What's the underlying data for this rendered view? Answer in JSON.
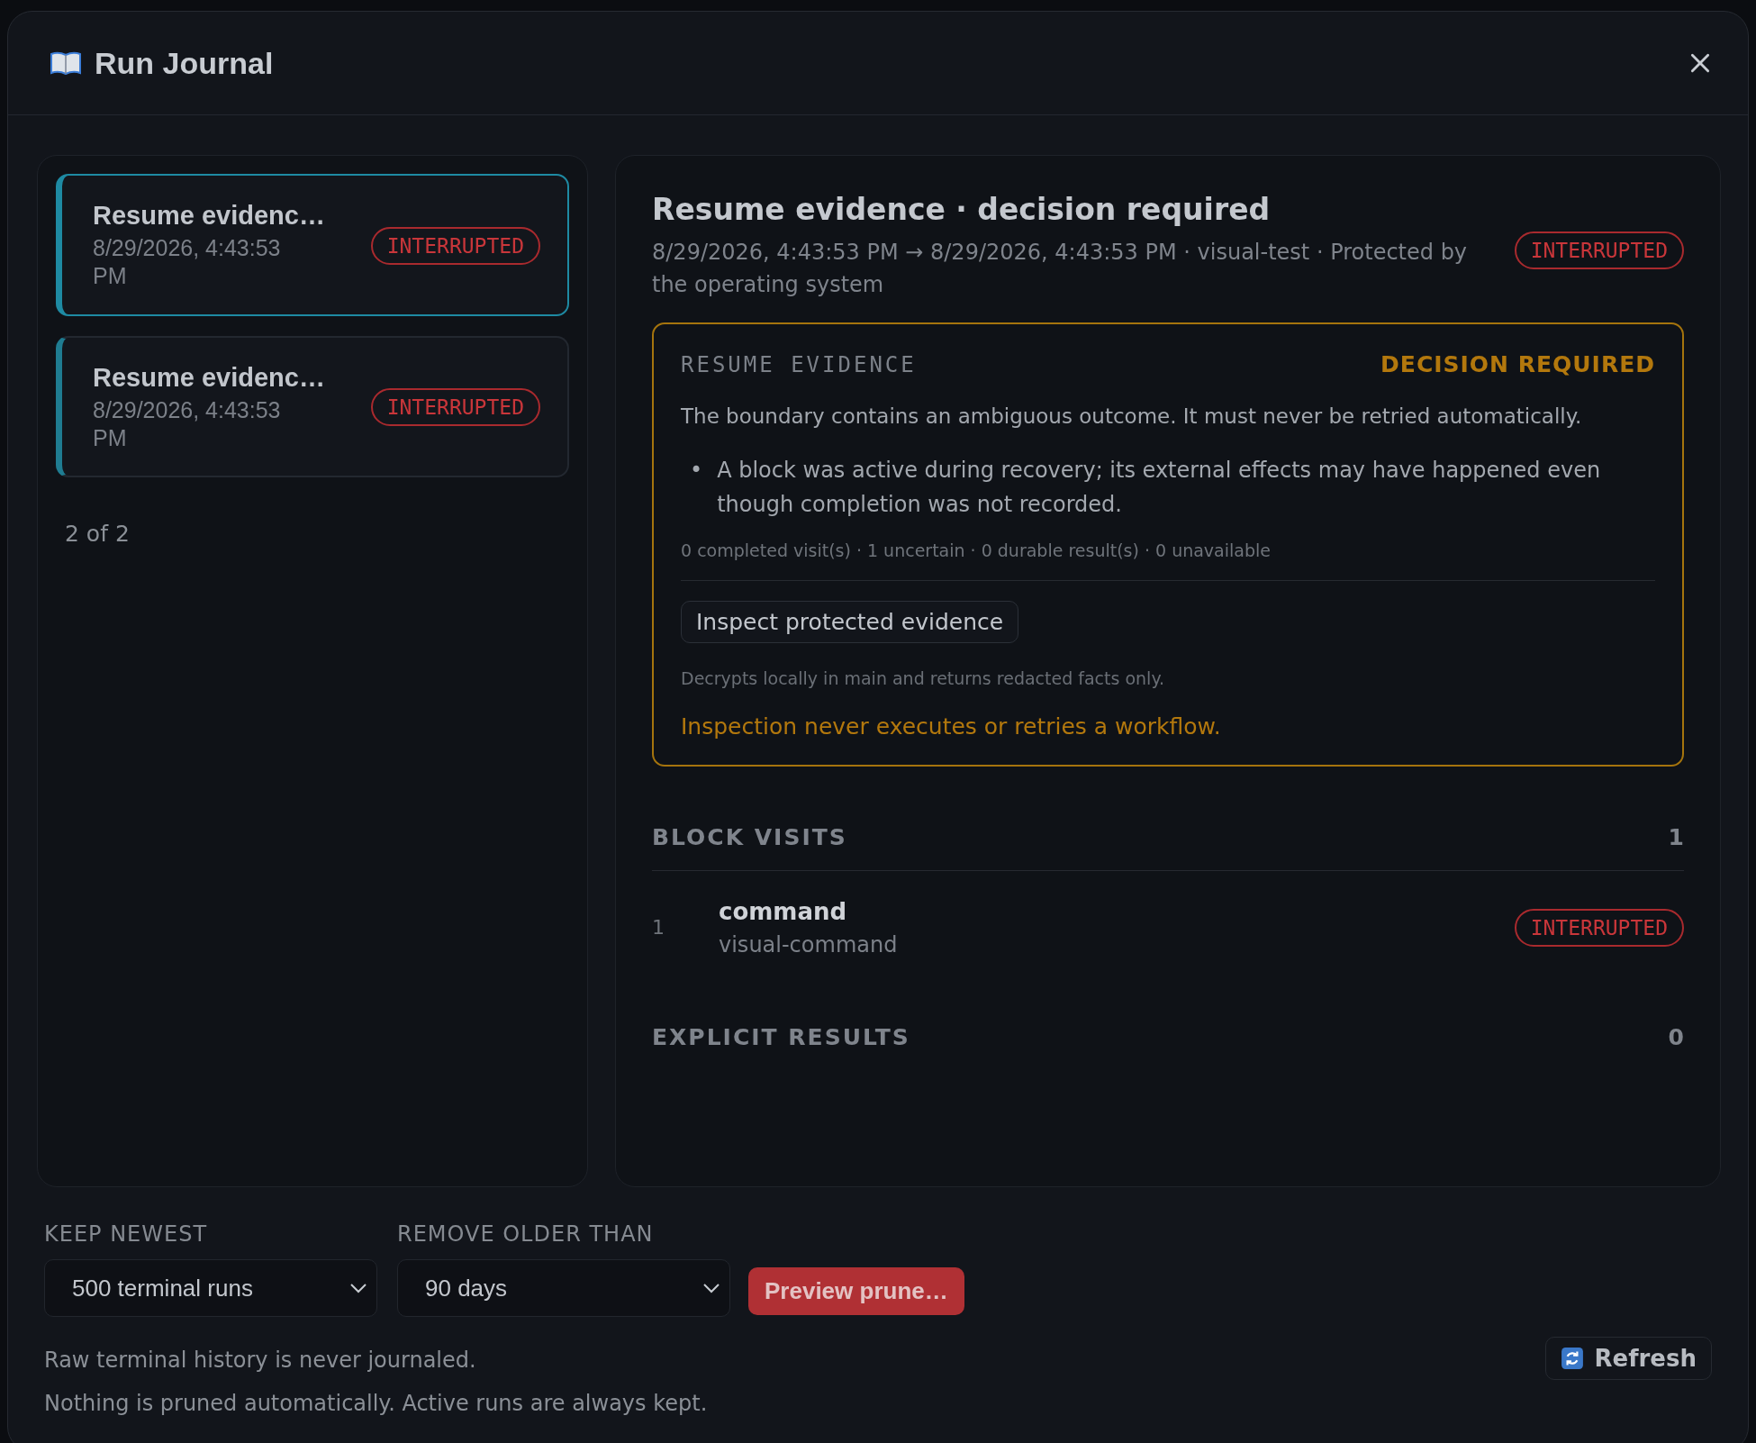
{
  "dialog": {
    "title": "Run Journal",
    "runs": [
      {
        "title": "Resume evidenc…",
        "time": "8/29/2026, 4:43:53 PM",
        "status": "INTERRUPTED",
        "selected": true
      },
      {
        "title": "Resume evidenc…",
        "time": "8/29/2026, 4:43:53 PM",
        "status": "INTERRUPTED",
        "selected": false
      }
    ],
    "pager": "2 of 2",
    "detail": {
      "title": "Resume evidence · decision required",
      "meta": "8/29/2026, 4:43:53 PM → 8/29/2026, 4:43:53 PM · visual-test · Protected by the operating system",
      "status": "INTERRUPTED",
      "evidence": {
        "label": "RESUME EVIDENCE",
        "flag": "DECISION REQUIRED",
        "summary": "The boundary contains an ambiguous outcome. It must never be retried automatically.",
        "bullets": [
          {
            "marker": "•",
            "text": "A block was active during recovery; its external effects may have happened even though completion was not recorded."
          }
        ],
        "stats": "0 completed visit(s) · 1 uncertain · 0 durable result(s) · 0 unavailable",
        "button": "Inspect protected evidence",
        "note": "Decrypts locally in main and returns redacted facts only.",
        "warning": "Inspection never executes or retries a workflow."
      },
      "sections": [
        {
          "title": "BLOCK VISITS",
          "count": "1",
          "rows": [
            {
              "index": "1",
              "name": "command",
              "detail": "visual-command",
              "status": "INTERRUPTED"
            }
          ]
        },
        {
          "title": "EXPLICIT RESULTS",
          "count": "0"
        }
      ]
    },
    "footer": {
      "filters": [
        {
          "label": "KEEP NEWEST",
          "value": "500 terminal runs"
        },
        {
          "label": "REMOVE OLDER THAN",
          "value": "90 days"
        }
      ],
      "button": "Preview prune…",
      "notes": [
        "Raw terminal history is never journaled.",
        "Nothing is pruned automatically. Active runs are always kept."
      ],
      "refresh": "Refresh"
    }
  }
}
